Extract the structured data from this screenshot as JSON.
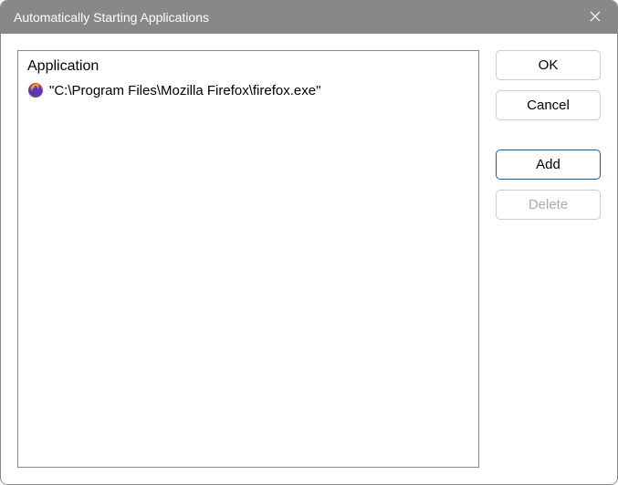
{
  "window": {
    "title": "Automatically Starting Applications"
  },
  "list": {
    "header": "Application",
    "items": [
      {
        "icon": "firefox-icon",
        "path": "\"C:\\Program Files\\Mozilla Firefox\\firefox.exe\""
      }
    ]
  },
  "buttons": {
    "ok": "OK",
    "cancel": "Cancel",
    "add": "Add",
    "delete": "Delete"
  }
}
